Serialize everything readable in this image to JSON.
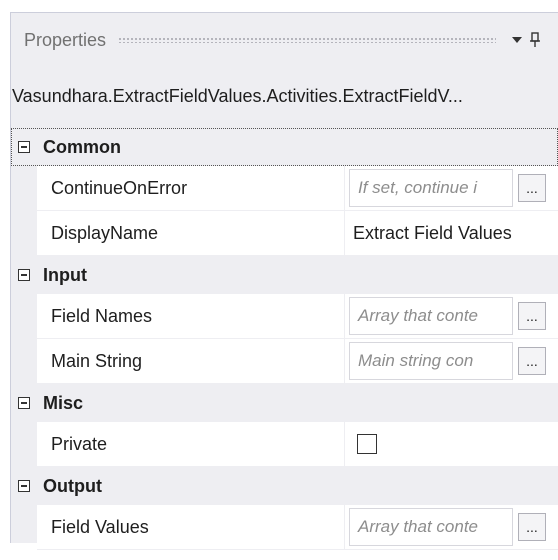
{
  "panel": {
    "title": "Properties",
    "dropdown_icon": "chevron-down-icon",
    "pin_icon": "pin-icon",
    "type_name": "Vasundhara.ExtractFieldValues.Activities.ExtractFieldV..."
  },
  "categories": {
    "common": {
      "label": "Common",
      "props": {
        "continue_on_error": {
          "name": "ContinueOnError",
          "placeholder": "If set, continue і",
          "button": "..."
        },
        "display_name": {
          "name": "DisplayName",
          "value": "Extract Field Values"
        }
      }
    },
    "input": {
      "label": "Input",
      "props": {
        "field_names": {
          "name": "Field Names",
          "placeholder": "Array that conte",
          "button": "..."
        },
        "main_string": {
          "name": "Main String",
          "placeholder": "Main string con",
          "button": "..."
        }
      }
    },
    "misc": {
      "label": "Misc",
      "props": {
        "private": {
          "name": "Private",
          "checked": false
        }
      }
    },
    "output": {
      "label": "Output",
      "props": {
        "field_values": {
          "name": "Field Values",
          "placeholder": "Array that conte",
          "button": "..."
        }
      }
    }
  }
}
